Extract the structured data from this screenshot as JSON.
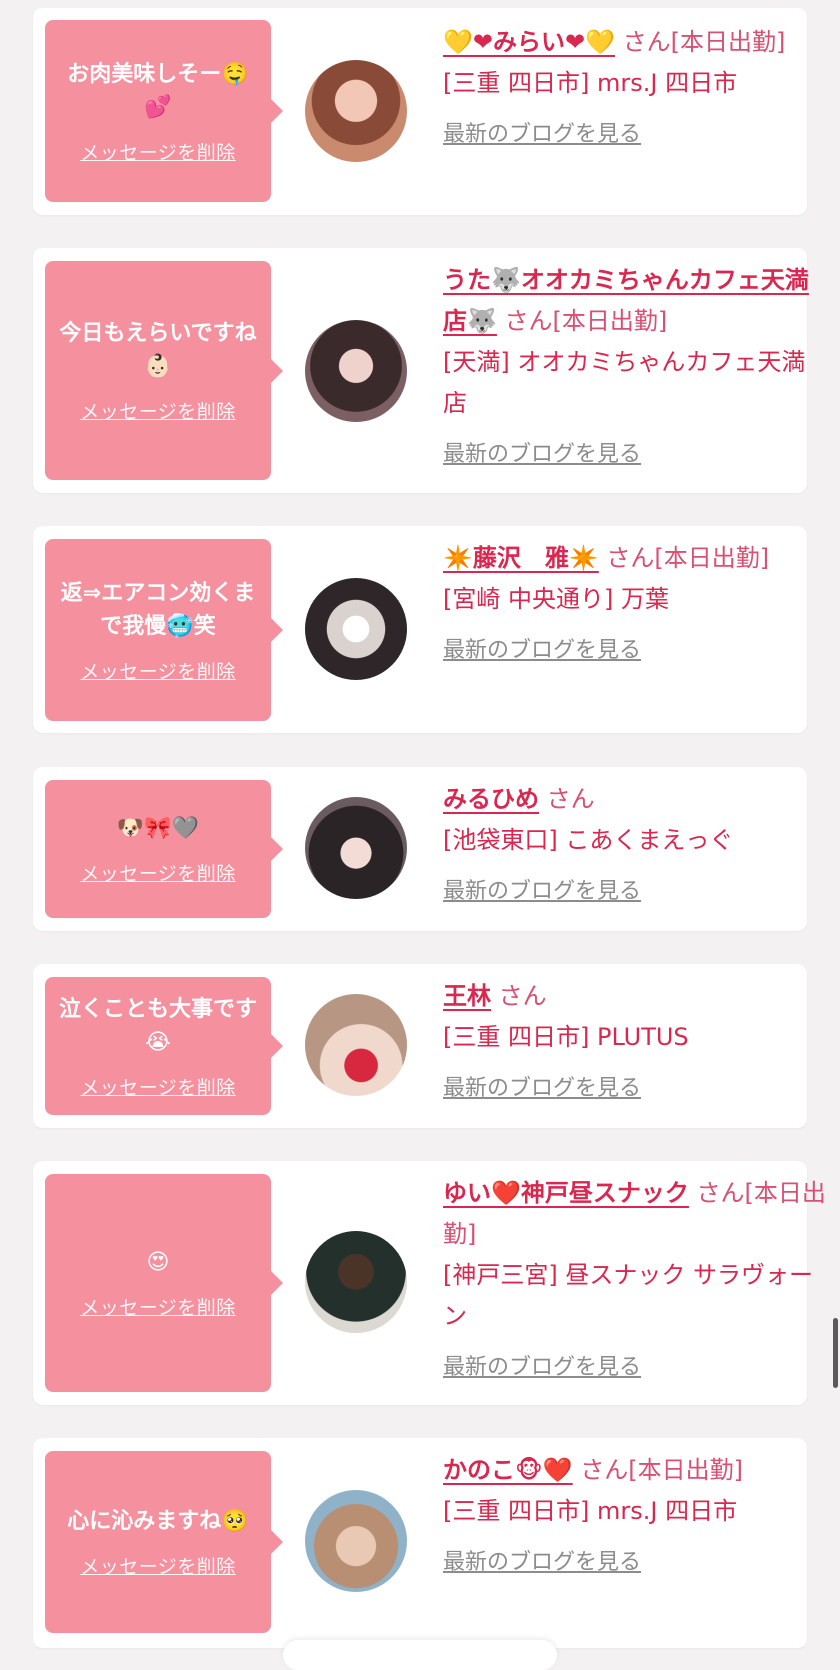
{
  "delete_label": "メッセージを削除",
  "blog_label": "最新のブログを見る",
  "honorific": "さん",
  "items": [
    {
      "message": "お肉美味しそー🤤💕",
      "name": "💛❤みらい❤💛",
      "status": "[本日出勤]",
      "shop": "[三重 四日市] mrs.J 四日市"
    },
    {
      "message": "今日もえらいですね👶🏻",
      "name": "うた🐺オオカミちゃんカフェ天満店🐺",
      "status": "[本日出勤]",
      "shop": "[天満] オオカミちゃんカフェ天満店"
    },
    {
      "message": "返⇒エアコン効くまで我慢🥶笑",
      "name": "✴️藤沢　雅✴️",
      "status": "[本日出勤]",
      "shop": "[宮崎 中央通り] 万葉"
    },
    {
      "message": "🐶🎀🩶",
      "name": "みるひめ",
      "status": "",
      "shop": "[池袋東口] こあくまえっぐ"
    },
    {
      "message": "泣くことも大事です😭",
      "name": "王林",
      "status": "",
      "shop": "[三重 四日市] PLUTUS"
    },
    {
      "message": "😍",
      "name": "ゆい❤️神戸昼スナック",
      "status": "[本日出勤]",
      "shop": "[神戸三宮] 昼スナック サラヴォーン"
    },
    {
      "message": "心に沁みますね🥺",
      "name": "かのこ🐵❤️",
      "status": "[本日出勤]",
      "shop": "[三重 四日市] mrs.J 四日市"
    }
  ]
}
